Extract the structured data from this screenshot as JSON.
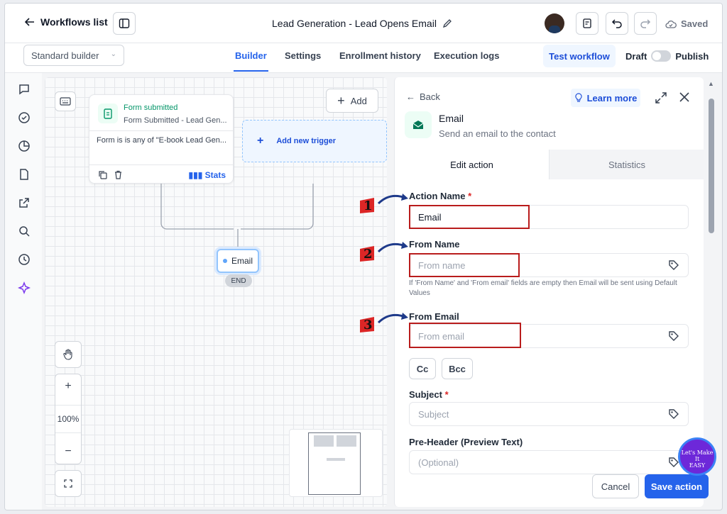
{
  "header": {
    "back_label": "Workflows list",
    "title": "Lead Generation - Lead Opens Email",
    "saved_label": "Saved"
  },
  "subbar": {
    "builder_mode": "Standard builder",
    "tabs": [
      "Builder",
      "Settings",
      "Enrollment history",
      "Execution logs"
    ],
    "active_tab": "Builder",
    "test_label": "Test workflow",
    "draft_label": "Draft",
    "publish_label": "Publish"
  },
  "canvas": {
    "add_label": "Add",
    "trigger": {
      "title": "Form submitted",
      "subtitle": "Form Submitted - Lead Gen...",
      "condition": "Form is is any of \"E-book Lead Gen...",
      "stats_label": "Stats"
    },
    "add_trigger_label": "Add new trigger",
    "email_node_label": "Email",
    "end_label": "END",
    "zoom_level": "100%",
    "zoom_in": "+",
    "zoom_out": "−"
  },
  "panel": {
    "back_label": "Back",
    "learn_more_label": "Learn more",
    "title": "Email",
    "description": "Send an email to the contact",
    "tabs": [
      "Edit action",
      "Statistics"
    ],
    "active_tab": "Edit action",
    "fields": {
      "action_name_label": "Action Name",
      "action_name_value": "Email",
      "from_name_label": "From Name",
      "from_name_placeholder": "From name",
      "hint": "If 'From Name' and 'From email' fields are empty then Email will be sent using Default Values",
      "from_email_label": "From Email",
      "from_email_placeholder": "From email",
      "cc_label": "Cc",
      "bcc_label": "Bcc",
      "subject_label": "Subject",
      "subject_placeholder": "Subject",
      "preheader_label": "Pre-Header (Preview Text)",
      "preheader_placeholder": "(Optional)",
      "required_mark": "*"
    },
    "cancel_label": "Cancel",
    "save_label": "Save action"
  },
  "markers": [
    "1",
    "2",
    "3"
  ],
  "watermark": "Let's Make It EASY",
  "colors": {
    "accent": "#2563eb",
    "success": "#059669",
    "highlight": "#b91c1c"
  }
}
